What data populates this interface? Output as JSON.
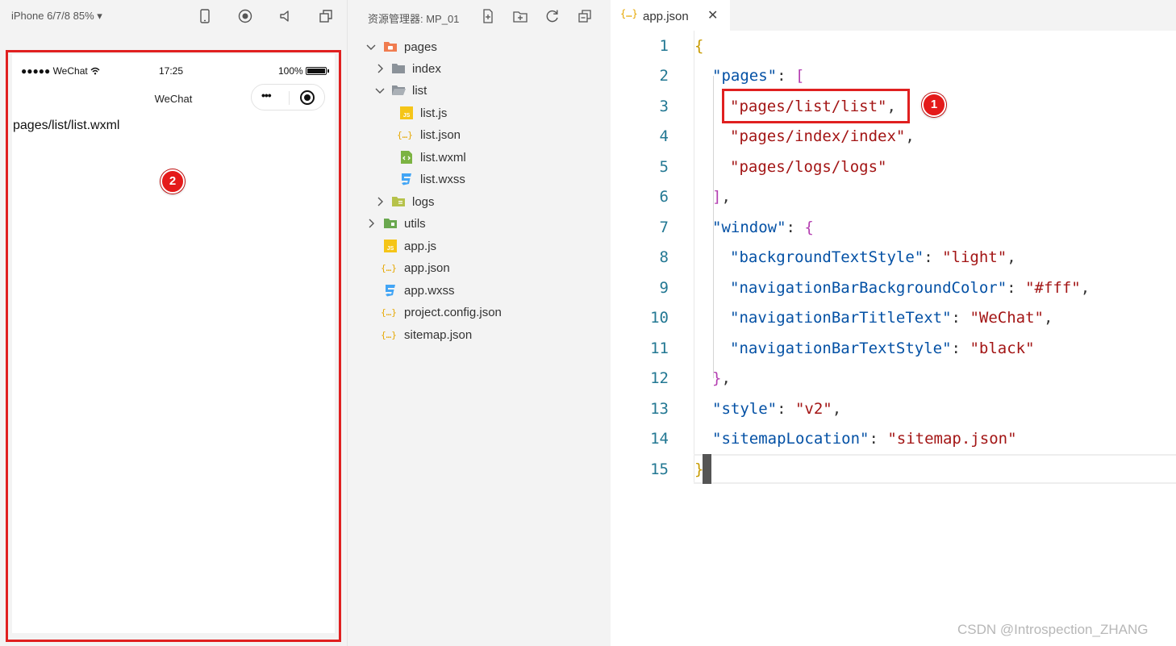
{
  "simulator": {
    "device_label": "iPhone 6/7/8 85% ▾",
    "toolbar_icons": [
      "phone-icon",
      "record-icon",
      "volume-icon",
      "window-icon"
    ],
    "status": {
      "carrier": "●●●●● WeChat",
      "time": "17:25",
      "battery": "100%"
    },
    "nav_title": "WeChat",
    "capsule_dots": "•••",
    "page_text": "pages/list/list.wxml"
  },
  "explorer": {
    "title": "资源管理器: MP_01",
    "toolbar_icons": [
      "new-file-icon",
      "new-folder-icon",
      "refresh-icon",
      "collapse-icon"
    ],
    "tree": [
      {
        "label": "pages",
        "type": "folder-open",
        "expanded": true
      },
      {
        "label": "index",
        "type": "folder",
        "expanded": false
      },
      {
        "label": "list",
        "type": "folder-open",
        "expanded": true
      },
      {
        "label": "list.js",
        "type": "js"
      },
      {
        "label": "list.json",
        "type": "json"
      },
      {
        "label": "list.wxml",
        "type": "wxml"
      },
      {
        "label": "list.wxss",
        "type": "wxss"
      },
      {
        "label": "logs",
        "type": "folder",
        "expanded": false
      },
      {
        "label": "utils",
        "type": "folder",
        "expanded": false
      },
      {
        "label": "app.js",
        "type": "js"
      },
      {
        "label": "app.json",
        "type": "json"
      },
      {
        "label": "app.wxss",
        "type": "wxss"
      },
      {
        "label": "project.config.json",
        "type": "json"
      },
      {
        "label": "sitemap.json",
        "type": "json"
      }
    ]
  },
  "editor": {
    "tab": {
      "icon_text": "{…}",
      "label": "app.json",
      "close": "✕"
    },
    "line_numbers": [
      "1",
      "2",
      "3",
      "4",
      "5",
      "6",
      "7",
      "8",
      "9",
      "10",
      "11",
      "12",
      "13",
      "14",
      "15"
    ],
    "code": {
      "l1_brace": "{",
      "pages_key": "\"pages\"",
      "pages_item_1": "\"pages/list/list\"",
      "pages_item_2": "\"pages/index/index\"",
      "pages_item_3": "\"pages/logs/logs\"",
      "window_key": "\"window\"",
      "bg_text_key": "\"backgroundTextStyle\"",
      "bg_text_val": "\"light\"",
      "nav_bg_key": "\"navigationBarBackgroundColor\"",
      "nav_bg_val": "\"#fff\"",
      "nav_title_key": "\"navigationBarTitleText\"",
      "nav_title_val": "\"WeChat\"",
      "nav_text_key": "\"navigationBarTextStyle\"",
      "nav_text_val": "\"black\"",
      "style_key": "\"style\"",
      "style_val": "\"v2\"",
      "sitemap_key": "\"sitemapLocation\"",
      "sitemap_val": "\"sitemap.json\"",
      "l15_brace": "}"
    }
  },
  "annotations": {
    "badge_1": "1",
    "badge_2": "2"
  },
  "watermark": "CSDN @Introspection_ZHANG",
  "colors": {
    "annotation_red": "#e02020",
    "json_key": "#0451a5",
    "json_string": "#a31515",
    "line_number": "#237893"
  }
}
